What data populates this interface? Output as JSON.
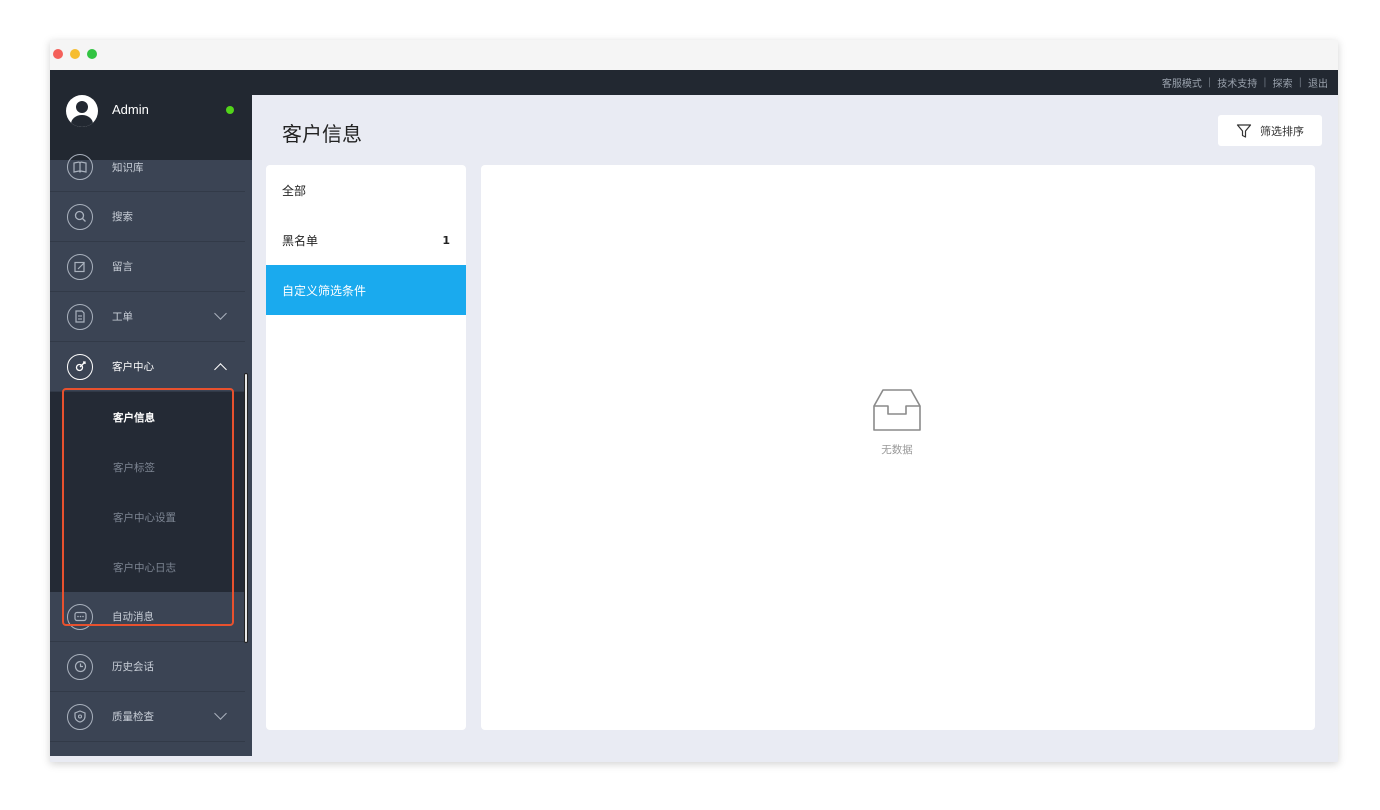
{
  "window": {
    "controls": [
      "close",
      "minimize",
      "zoom"
    ]
  },
  "topbar": {
    "links": [
      "客服模式",
      "技术支持",
      "探索",
      "退出"
    ],
    "separator": "|"
  },
  "user": {
    "name": "Admin",
    "status_color": "#52d41a"
  },
  "sidebar": {
    "items": [
      {
        "label": "知识库",
        "icon": "book-icon"
      },
      {
        "label": "搜索",
        "icon": "search-icon"
      },
      {
        "label": "留言",
        "icon": "edit-note-icon"
      },
      {
        "label": "工单",
        "icon": "document-icon",
        "expandable": true
      },
      {
        "label": "客户中心",
        "icon": "target-icon",
        "expanded": true
      },
      {
        "label": "自动消息",
        "icon": "chat-icon"
      },
      {
        "label": "历史会话",
        "icon": "clock-icon"
      },
      {
        "label": "质量检查",
        "icon": "shield-icon",
        "expandable": true
      }
    ],
    "sub_items": [
      {
        "label": "客户信息",
        "active": true
      },
      {
        "label": "客户标签"
      },
      {
        "label": "客户中心设置"
      },
      {
        "label": "客户中心日志"
      }
    ]
  },
  "main": {
    "title": "客户信息",
    "filter_button": "筛选排序",
    "left_list": [
      {
        "label": "全部",
        "count": ""
      },
      {
        "label": "黑名单",
        "count": "1"
      },
      {
        "label": "自定义筛选条件",
        "count": "",
        "active": true
      }
    ],
    "empty_text": "无数据"
  },
  "colors": {
    "accent": "#1aaaee",
    "highlight_border": "#e8512e",
    "sidebar_bg": "#3b4454",
    "topbar_bg": "#222831"
  }
}
